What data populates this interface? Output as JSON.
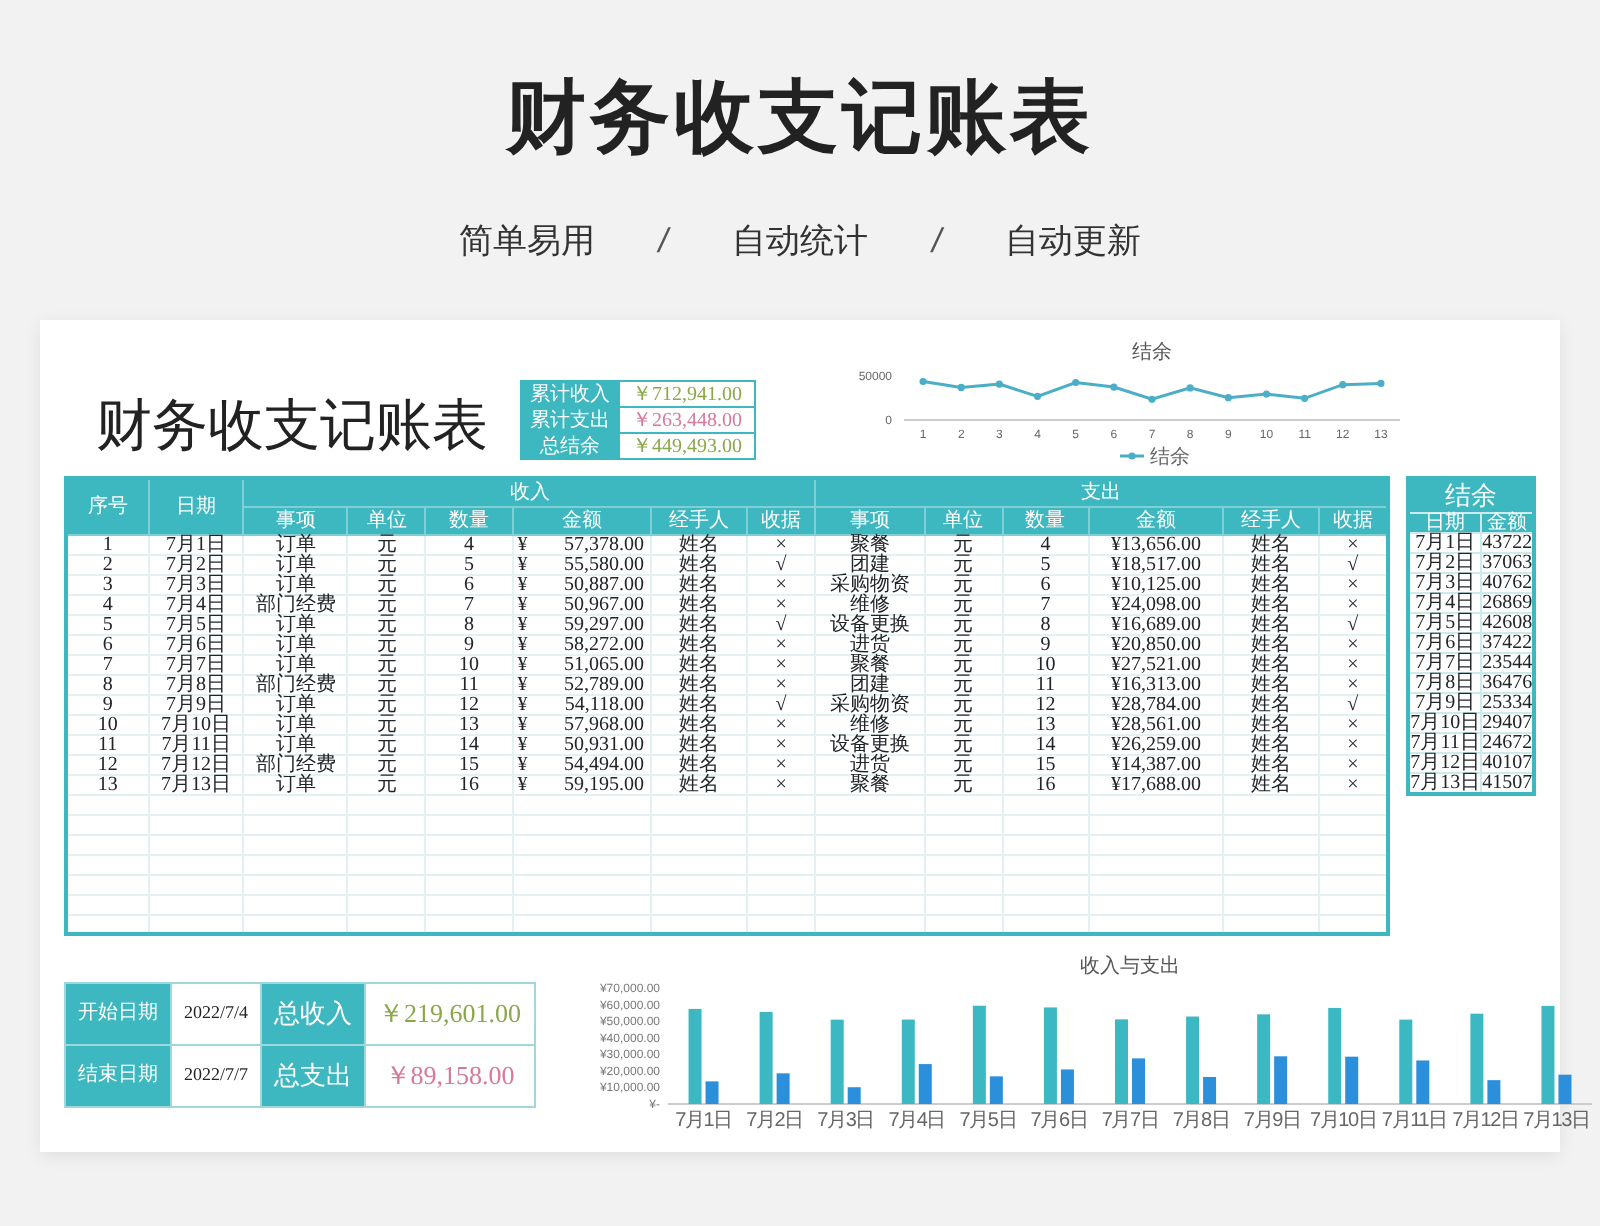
{
  "header": {
    "title": "财务收支记账表",
    "taglines": [
      {
        "kind": "text",
        "text": "简单易用"
      },
      {
        "kind": "separator",
        "text": "/"
      },
      {
        "kind": "text",
        "text": "自动统计"
      },
      {
        "kind": "separator",
        "text": "/"
      },
      {
        "kind": "text",
        "text": "自动更新"
      }
    ]
  },
  "sheet": {
    "title": "财务收支记账表",
    "totals": [
      {
        "label": "累计收入",
        "value": "￥712,941.00",
        "kind": "income"
      },
      {
        "label": "累计支出",
        "value": "￥263,448.00",
        "kind": "expense"
      },
      {
        "label": "总结余",
        "value": "￥449,493.00",
        "kind": "balance"
      }
    ],
    "balance_chart": {
      "chart_data": {
        "type": "line",
        "title": "结余",
        "x": [
          1,
          2,
          3,
          4,
          5,
          6,
          7,
          8,
          9,
          10,
          11,
          12,
          13
        ],
        "xlim": [
          0.5,
          13.5
        ],
        "xticks": [
          1,
          2,
          3,
          4,
          5,
          6,
          7,
          8,
          9,
          10,
          11,
          12,
          13
        ],
        "ylim": [
          0,
          50000
        ],
        "yticks": [
          0,
          50000
        ],
        "series": [
          {
            "name": "结余",
            "color": "#4aaec6",
            "marker": "circle",
            "values": [
              43722,
              37063,
              40762,
              26869,
              42608,
              37422,
              23544,
              36476,
              25334,
              29407,
              24672,
              40107,
              41507
            ]
          }
        ]
      }
    }
  },
  "ledger": {
    "no_header": "序号",
    "date_header": "日期",
    "income_header": "收入",
    "expense_header": "支出",
    "sub_columns": [
      "事项",
      "单位",
      "数量",
      "金额",
      "经手人",
      "收据"
    ],
    "expense_sub_columns": [
      "事项",
      "单位",
      "数量",
      "金额",
      "经手人",
      "收据"
    ],
    "rows": [
      {
        "no": "1",
        "date": "7月1日",
        "income": {
          "item": "订单",
          "unit": "元",
          "qty": "4",
          "currency": "¥",
          "amount": "57,378.00",
          "handler": "姓名",
          "receipt": "×"
        },
        "expense": {
          "item": "聚餐",
          "unit": "元",
          "qty": "4",
          "amount": "¥13,656.00",
          "handler": "姓名",
          "receipt": "×"
        }
      },
      {
        "no": "2",
        "date": "7月2日",
        "income": {
          "item": "订单",
          "unit": "元",
          "qty": "5",
          "currency": "¥",
          "amount": "55,580.00",
          "handler": "姓名",
          "receipt": "√"
        },
        "expense": {
          "item": "团建",
          "unit": "元",
          "qty": "5",
          "amount": "¥18,517.00",
          "handler": "姓名",
          "receipt": "√"
        }
      },
      {
        "no": "3",
        "date": "7月3日",
        "income": {
          "item": "订单",
          "unit": "元",
          "qty": "6",
          "currency": "¥",
          "amount": "50,887.00",
          "handler": "姓名",
          "receipt": "×"
        },
        "expense": {
          "item": "采购物资",
          "unit": "元",
          "qty": "6",
          "amount": "¥10,125.00",
          "handler": "姓名",
          "receipt": "×"
        }
      },
      {
        "no": "4",
        "date": "7月4日",
        "income": {
          "item": "部门经费",
          "unit": "元",
          "qty": "7",
          "currency": "¥",
          "amount": "50,967.00",
          "handler": "姓名",
          "receipt": "×"
        },
        "expense": {
          "item": "维修",
          "unit": "元",
          "qty": "7",
          "amount": "¥24,098.00",
          "handler": "姓名",
          "receipt": "×"
        }
      },
      {
        "no": "5",
        "date": "7月5日",
        "income": {
          "item": "订单",
          "unit": "元",
          "qty": "8",
          "currency": "¥",
          "amount": "59,297.00",
          "handler": "姓名",
          "receipt": "√"
        },
        "expense": {
          "item": "设备更换",
          "unit": "元",
          "qty": "8",
          "amount": "¥16,689.00",
          "handler": "姓名",
          "receipt": "√"
        }
      },
      {
        "no": "6",
        "date": "7月6日",
        "income": {
          "item": "订单",
          "unit": "元",
          "qty": "9",
          "currency": "¥",
          "amount": "58,272.00",
          "handler": "姓名",
          "receipt": "×"
        },
        "expense": {
          "item": "进货",
          "unit": "元",
          "qty": "9",
          "amount": "¥20,850.00",
          "handler": "姓名",
          "receipt": "×"
        }
      },
      {
        "no": "7",
        "date": "7月7日",
        "income": {
          "item": "订单",
          "unit": "元",
          "qty": "10",
          "currency": "¥",
          "amount": "51,065.00",
          "handler": "姓名",
          "receipt": "×"
        },
        "expense": {
          "item": "聚餐",
          "unit": "元",
          "qty": "10",
          "amount": "¥27,521.00",
          "handler": "姓名",
          "receipt": "×"
        }
      },
      {
        "no": "8",
        "date": "7月8日",
        "income": {
          "item": "部门经费",
          "unit": "元",
          "qty": "11",
          "currency": "¥",
          "amount": "52,789.00",
          "handler": "姓名",
          "receipt": "×"
        },
        "expense": {
          "item": "团建",
          "unit": "元",
          "qty": "11",
          "amount": "¥16,313.00",
          "handler": "姓名",
          "receipt": "×"
        }
      },
      {
        "no": "9",
        "date": "7月9日",
        "income": {
          "item": "订单",
          "unit": "元",
          "qty": "12",
          "currency": "¥",
          "amount": "54,118.00",
          "handler": "姓名",
          "receipt": "√"
        },
        "expense": {
          "item": "采购物资",
          "unit": "元",
          "qty": "12",
          "amount": "¥28,784.00",
          "handler": "姓名",
          "receipt": "√"
        }
      },
      {
        "no": "10",
        "date": "7月10日",
        "income": {
          "item": "订单",
          "unit": "元",
          "qty": "13",
          "currency": "¥",
          "amount": "57,968.00",
          "handler": "姓名",
          "receipt": "×"
        },
        "expense": {
          "item": "维修",
          "unit": "元",
          "qty": "13",
          "amount": "¥28,561.00",
          "handler": "姓名",
          "receipt": "×"
        }
      },
      {
        "no": "11",
        "date": "7月11日",
        "income": {
          "item": "订单",
          "unit": "元",
          "qty": "14",
          "currency": "¥",
          "amount": "50,931.00",
          "handler": "姓名",
          "receipt": "×"
        },
        "expense": {
          "item": "设备更换",
          "unit": "元",
          "qty": "14",
          "amount": "¥26,259.00",
          "handler": "姓名",
          "receipt": "×"
        }
      },
      {
        "no": "12",
        "date": "7月12日",
        "income": {
          "item": "部门经费",
          "unit": "元",
          "qty": "15",
          "currency": "¥",
          "amount": "54,494.00",
          "handler": "姓名",
          "receipt": "×"
        },
        "expense": {
          "item": "进货",
          "unit": "元",
          "qty": "15",
          "amount": "¥14,387.00",
          "handler": "姓名",
          "receipt": "×"
        }
      },
      {
        "no": "13",
        "date": "7月13日",
        "income": {
          "item": "订单",
          "unit": "元",
          "qty": "16",
          "currency": "¥",
          "amount": "59,195.00",
          "handler": "姓名",
          "receipt": "×"
        },
        "expense": {
          "item": "聚餐",
          "unit": "元",
          "qty": "16",
          "amount": "¥17,688.00",
          "handler": "姓名",
          "receipt": "×"
        }
      }
    ]
  },
  "balance_table": {
    "title": "结余",
    "columns": [
      "日期",
      "金额"
    ],
    "rows": [
      [
        "7月1日",
        "43722"
      ],
      [
        "7月2日",
        "37063"
      ],
      [
        "7月3日",
        "40762"
      ],
      [
        "7月4日",
        "26869"
      ],
      [
        "7月5日",
        "42608"
      ],
      [
        "7月6日",
        "37422"
      ],
      [
        "7月7日",
        "23544"
      ],
      [
        "7月8日",
        "36476"
      ],
      [
        "7月9日",
        "25334"
      ],
      [
        "7月10日",
        "29407"
      ],
      [
        "7月11日",
        "24672"
      ],
      [
        "7月12日",
        "40107"
      ],
      [
        "7月13日",
        "41507"
      ]
    ]
  },
  "period_summary": [
    {
      "label": "开始日期",
      "value": "2022/7/4",
      "total_label": "总收入",
      "total": "￥219,601.00",
      "kind": "income"
    },
    {
      "label": "结束日期",
      "value": "2022/7/7",
      "total_label": "总支出",
      "total": "￥89,158.00",
      "kind": "expense"
    }
  ],
  "bar_chart": {
    "chart_data": {
      "type": "bar",
      "title": "收入与支出",
      "categories": [
        "7月1日",
        "7月2日",
        "7月3日",
        "7月4日",
        "7月5日",
        "7月6日",
        "7月7日",
        "7月8日",
        "7月9日",
        "7月10日",
        "7月11日",
        "7月12日",
        "7月13日"
      ],
      "ylim": [
        0,
        70000
      ],
      "yticks": [
        {
          "value": 0,
          "label": "¥-"
        },
        {
          "value": 10000,
          "label": "¥10,000.00"
        },
        {
          "value": 20000,
          "label": "¥20,000.00"
        },
        {
          "value": 30000,
          "label": "¥30,000.00"
        },
        {
          "value": 40000,
          "label": "¥40,000.00"
        },
        {
          "value": 50000,
          "label": "¥50,000.00"
        },
        {
          "value": 60000,
          "label": "¥60,000.00"
        },
        {
          "value": 70000,
          "label": "¥70,000.00"
        }
      ],
      "series": [
        {
          "color": "#3cb8c2",
          "values": [
            57378,
            55580,
            50887,
            50967,
            59297,
            58272,
            51065,
            52789,
            54118,
            57968,
            50931,
            54494,
            59195
          ]
        },
        {
          "color": "#2b8fdc",
          "values": [
            13656,
            18517,
            10125,
            24098,
            16689,
            20850,
            27521,
            16313,
            28784,
            28561,
            26259,
            14387,
            17688
          ]
        }
      ]
    }
  }
}
